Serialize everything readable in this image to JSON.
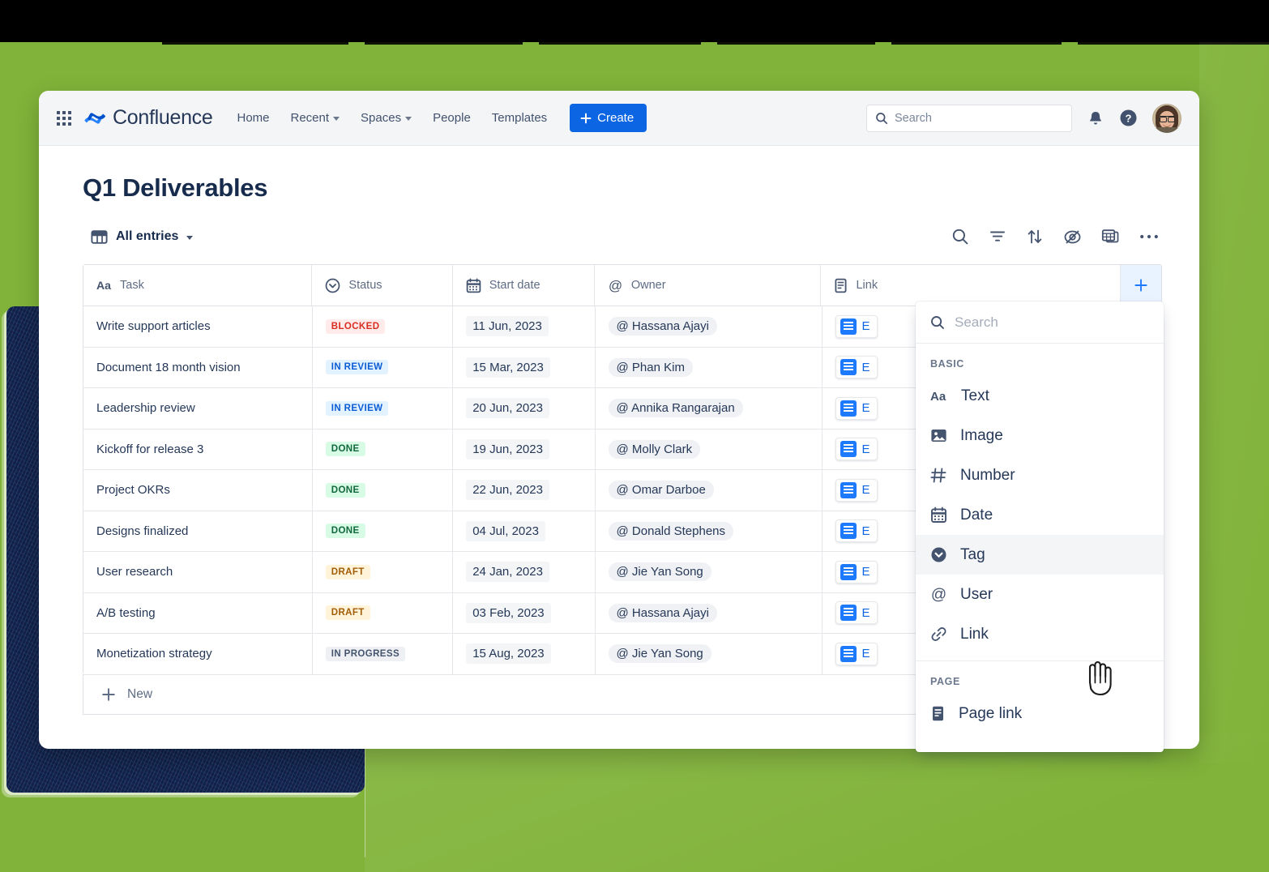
{
  "colors": {
    "background_green": "#81b33a",
    "brand_blue": "#0c66e4",
    "text_dark": "#172b4d",
    "shadow_card_navy": "#10204a"
  },
  "topnav": {
    "app_switcher": "app-switcher-icon",
    "brand": "Confluence",
    "links": [
      {
        "label": "Home",
        "has_caret": false
      },
      {
        "label": "Recent",
        "has_caret": true
      },
      {
        "label": "Spaces",
        "has_caret": true
      },
      {
        "label": "People",
        "has_caret": false
      },
      {
        "label": "Templates",
        "has_caret": false
      }
    ],
    "create_button": "Create",
    "search_placeholder": "Search",
    "notifications_icon": "bell-icon",
    "help_icon": "help-circle-icon",
    "avatar": "user-avatar"
  },
  "page": {
    "title": "Q1 Deliverables"
  },
  "db_toolbar": {
    "view_label": "All entries",
    "actions": [
      "search-icon",
      "filter-icon",
      "sort-icon",
      "hide-fields-icon",
      "view-switcher-icon",
      "more-actions-icon"
    ]
  },
  "table": {
    "columns": [
      {
        "label": "Task",
        "icon": "text-icon"
      },
      {
        "label": "Status",
        "icon": "tag-icon"
      },
      {
        "label": "Start date",
        "icon": "calendar-icon"
      },
      {
        "label": "Owner",
        "icon": "user-icon"
      },
      {
        "label": "Link",
        "icon": "page-icon"
      }
    ],
    "add_column_label": "+",
    "rows": [
      {
        "task": "Write support articles",
        "status": "BLOCKED",
        "status_style": "blocked",
        "date": "11 Jun, 2023",
        "owner": "@ Hassana Ajayi",
        "link": "E"
      },
      {
        "task": "Document 18 month vision",
        "status": "IN REVIEW",
        "status_style": "inreview",
        "date": "15 Mar, 2023",
        "owner": "@ Phan Kim",
        "link": "E"
      },
      {
        "task": "Leadership review",
        "status": "IN REVIEW",
        "status_style": "inreview",
        "date": "20 Jun, 2023",
        "owner": "@ Annika Rangarajan",
        "link": "E"
      },
      {
        "task": "Kickoff for release 3",
        "status": "DONE",
        "status_style": "done",
        "date": "19 Jun, 2023",
        "owner": "@ Molly Clark",
        "link": "E"
      },
      {
        "task": "Project OKRs",
        "status": "DONE",
        "status_style": "done",
        "date": "22 Jun, 2023",
        "owner": "@ Omar Darboe",
        "link": "E"
      },
      {
        "task": "Designs finalized",
        "status": "DONE",
        "status_style": "done",
        "date": "04 Jul, 2023",
        "owner": "@ Donald Stephens",
        "link": "E"
      },
      {
        "task": "User research",
        "status": "DRAFT",
        "status_style": "draft",
        "date": "24 Jan, 2023",
        "owner": "@ Jie Yan Song",
        "link": "E"
      },
      {
        "task": "A/B testing",
        "status": "DRAFT",
        "status_style": "draft",
        "date": "03 Feb, 2023",
        "owner": "@ Hassana Ajayi",
        "link": "E"
      },
      {
        "task": "Monetization strategy",
        "status": "IN PROGRESS",
        "status_style": "inprogress",
        "date": "15 Aug, 2023",
        "owner": "@ Jie Yan Song",
        "link": "E"
      }
    ],
    "new_row_label": "New"
  },
  "field_menu": {
    "search_placeholder": "Search",
    "sections": [
      {
        "title": "BASIC",
        "items": [
          {
            "label": "Text",
            "icon": "text-icon",
            "hover": false
          },
          {
            "label": "Image",
            "icon": "image-icon",
            "hover": false
          },
          {
            "label": "Number",
            "icon": "number-icon",
            "hover": false
          },
          {
            "label": "Date",
            "icon": "calendar-icon",
            "hover": false
          },
          {
            "label": "Tag",
            "icon": "tag-icon",
            "hover": true
          },
          {
            "label": "User",
            "icon": "user-icon",
            "hover": false
          },
          {
            "label": "Link",
            "icon": "link-icon",
            "hover": false
          }
        ]
      },
      {
        "title": "PAGE",
        "items": [
          {
            "label": "Page link",
            "icon": "page-icon",
            "hover": false
          }
        ]
      }
    ]
  },
  "cursor": {
    "icon": "pointing-hand-cursor"
  }
}
